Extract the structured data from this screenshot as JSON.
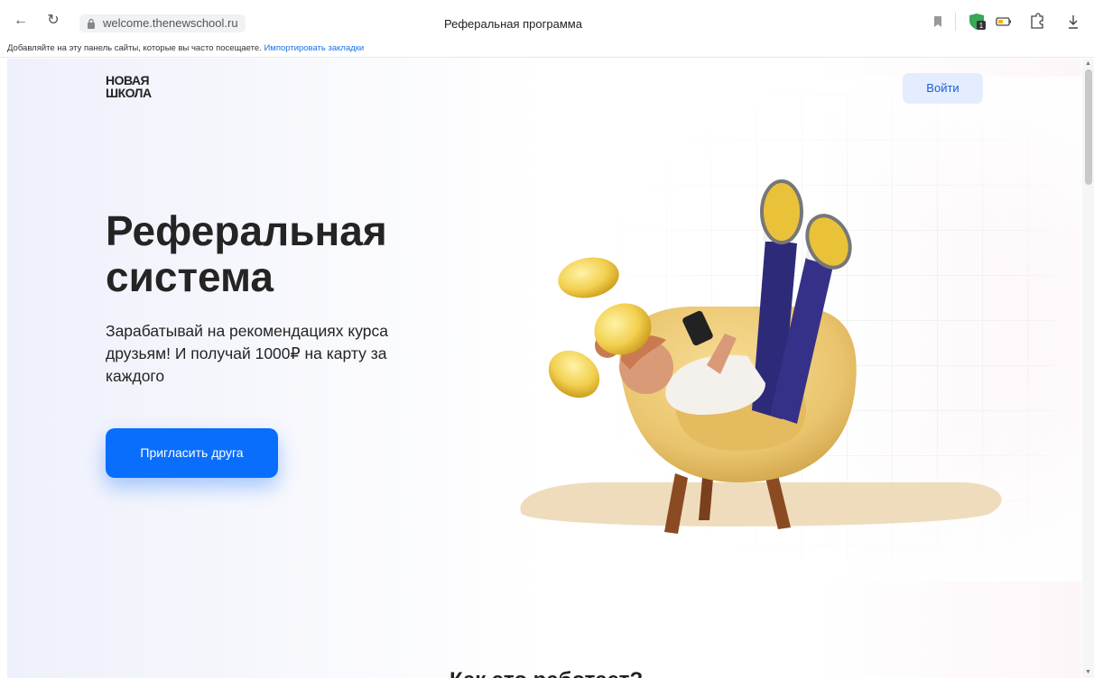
{
  "browser": {
    "url": "welcome.thenewschool.ru",
    "tab_title": "Реферальная программа",
    "bookmarks_hint": "Добавляйте на эту панель сайты, которые вы часто посещаете.",
    "import_link": "Импортировать закладки"
  },
  "page": {
    "logo_line1": "НОВАЯ",
    "logo_line2": "ШКОЛА",
    "login_label": "Войти",
    "hero_title": "Реферальная система",
    "hero_subtitle": "Зарабатывай на рекомендациях курса друзьям! И получай  1000₽ на карту за каждого",
    "invite_label": "Пригласить друга",
    "next_section_title": "Как это работает?"
  },
  "colors": {
    "accent": "#0a6efc",
    "login_bg": "#e3edfd",
    "login_text": "#1a5fd6"
  },
  "icons": {
    "back": "arrow-left-icon",
    "reload": "reload-icon",
    "lock": "lock-icon",
    "bookmark": "bookmark-icon",
    "extension": "shield-extension-icon",
    "battery": "battery-icon",
    "puzzle": "puzzle-icon",
    "download": "download-icon"
  }
}
